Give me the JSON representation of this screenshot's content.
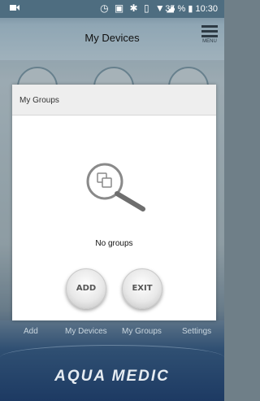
{
  "status_bar": {
    "battery": "35 %",
    "time": "10:30"
  },
  "header": {
    "title": "My Devices",
    "menu_label": "MENU"
  },
  "bottom_nav": {
    "items": [
      {
        "label": "Add"
      },
      {
        "label": "My Devices"
      },
      {
        "label": "My Groups"
      },
      {
        "label": "Settings"
      }
    ]
  },
  "brand": {
    "logo_text": "AQUA MEDIC"
  },
  "dialog": {
    "title": "My Groups",
    "empty_text": "No groups",
    "add_label": "ADD",
    "exit_label": "EXIT"
  },
  "colors": {
    "dialog_header_bg": "#eeeeee",
    "nav_text": "#c9d6df",
    "brand_blue": "#1d3a63"
  }
}
